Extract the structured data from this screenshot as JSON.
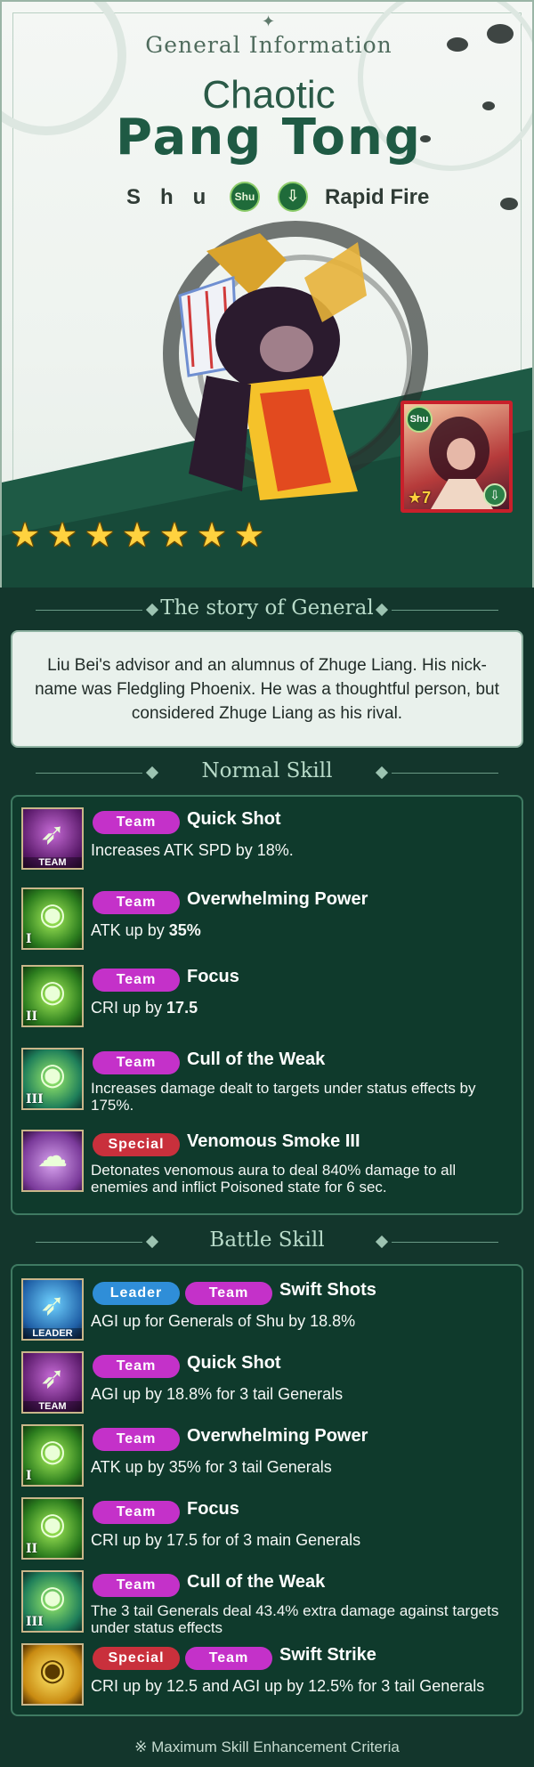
{
  "header": {
    "section_title": "General Information",
    "name_prefix": "Chaotic",
    "name": "Pang Tong",
    "faction": "Shu",
    "faction_badge": "Shu",
    "type": "Rapid Fire",
    "type_icon": "arrow-down-icon",
    "card": {
      "faction_badge": "Shu",
      "star_level": "★7"
    },
    "star_count": 7
  },
  "story": {
    "title": "The story of General",
    "text": "Liu Bei's advisor and an alumnus of Zhuge Liang. His nick-name was Fledgling Phoenix. He was a thoughtful person, but considered Zhuge Liang as his rival."
  },
  "normal_skill": {
    "title": "Normal Skill",
    "items": [
      {
        "tag": "Team",
        "name": "Quick Shot",
        "desc": "Increases ATK SPD by 18%.",
        "icon_tag": "TEAM"
      },
      {
        "tag": "Team",
        "name": "Overwhelming Power",
        "desc_prefix": "ATK up by ",
        "desc_bold": "35%",
        "icon_roman": "I"
      },
      {
        "tag": "Team",
        "name": "Focus",
        "desc_prefix": "CRI up by ",
        "desc_bold": "17.5",
        "icon_roman": "II"
      },
      {
        "tag": "Team",
        "name": "Cull of the Weak",
        "desc": "Increases damage dealt to targets under status effects by 175%.",
        "icon_roman": "III"
      },
      {
        "tag": "Special",
        "name": "Venomous Smoke III",
        "desc": "Detonates venomous aura to deal 840% damage to all enemies and inflict Poisoned state for 6 sec."
      }
    ]
  },
  "battle_skill": {
    "title": "Battle Skill",
    "items": [
      {
        "tag": "Leader",
        "tag2": "Team",
        "name": "Swift Shots",
        "desc": "AGI up for Generals of Shu by 18.8%",
        "icon_tag": "LEADER"
      },
      {
        "tag": "Team",
        "name": "Quick Shot",
        "desc": "AGI up by 18.8% for 3 tail Generals",
        "icon_tag": "TEAM"
      },
      {
        "tag": "Team",
        "name": "Overwhelming Power",
        "desc": "ATK up by 35% for 3 tail Generals",
        "icon_roman": "I"
      },
      {
        "tag": "Team",
        "name": "Focus",
        "desc": "CRI up by 17.5 for of 3 main Generals",
        "icon_roman": "II"
      },
      {
        "tag": "Team",
        "name": "Cull of the Weak",
        "desc": "The 3 tail Generals deal 43.4% extra damage against targets under status effects",
        "icon_roman": "III"
      },
      {
        "tag": "Special",
        "tag2": "Team",
        "name": "Swift Strike",
        "desc": "CRI up by 12.5 and AGI up by 12.5% for 3 tail Generals"
      }
    ]
  },
  "footer": {
    "note": "※ Maximum Skill Enhancement Criteria"
  },
  "colors": {
    "team": "#c431c9",
    "special": "#c9303c",
    "leader": "#2f8ed8",
    "background": "#13362c"
  }
}
